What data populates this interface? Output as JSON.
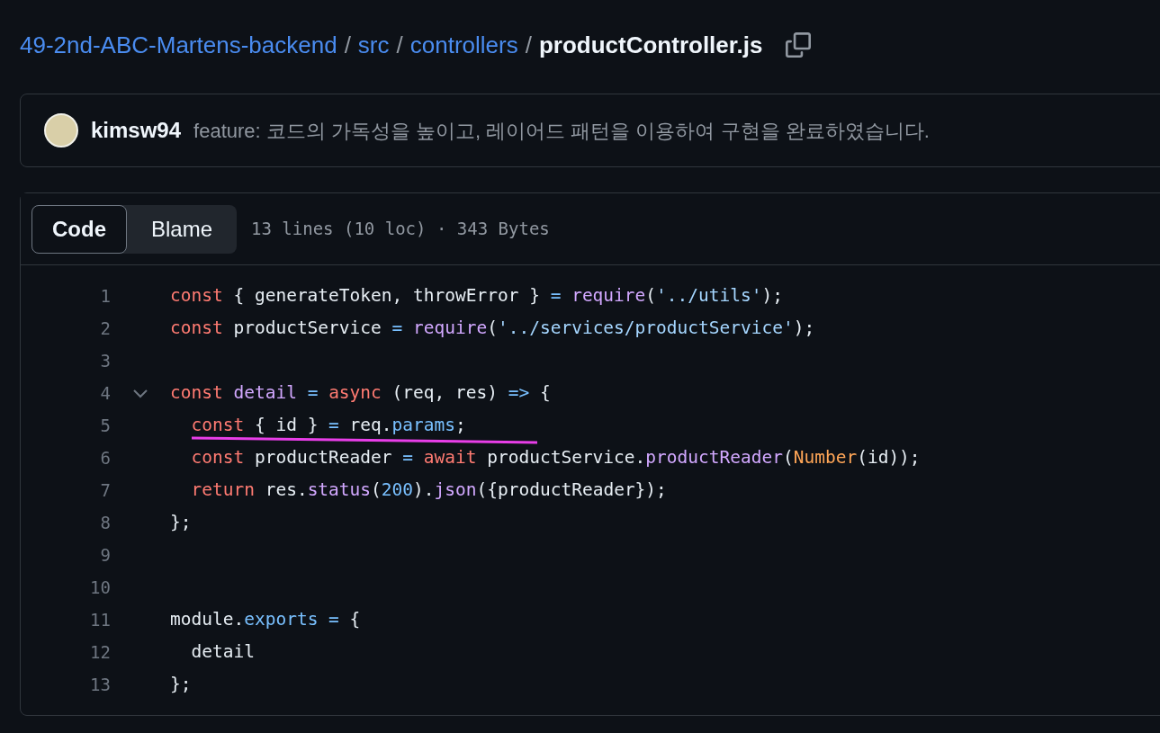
{
  "breadcrumb": [
    {
      "label": "49-2nd-ABC-Martens-backend",
      "kind": "link"
    },
    {
      "label": "src",
      "kind": "link"
    },
    {
      "label": "controllers",
      "kind": "link"
    },
    {
      "label": "productController.js",
      "kind": "current"
    }
  ],
  "breadcrumb_separator": "/",
  "commit": {
    "author": "kimsw94",
    "message": "feature: 코드의 가독성을 높이고, 레이어드 패턴을 이용하여 구현을 완료하였습니다."
  },
  "tabs": [
    {
      "label": "Code",
      "selected": true
    },
    {
      "label": "Blame",
      "selected": false
    }
  ],
  "file_info": "13 lines (10 loc) · 343 Bytes",
  "lines": [
    {
      "number": "1",
      "foldable": false,
      "marked": false,
      "tokens": [
        {
          "t": "const",
          "kind": "kw"
        },
        {
          "t": " { generateToken, throwError } ",
          "kind": "plain"
        },
        {
          "t": "= ",
          "kind": "op"
        },
        {
          "t": "require",
          "kind": "fn"
        },
        {
          "t": "(",
          "kind": "plain"
        },
        {
          "t": "'../utils'",
          "kind": "str"
        },
        {
          "t": ");",
          "kind": "plain"
        }
      ]
    },
    {
      "number": "2",
      "foldable": false,
      "marked": false,
      "tokens": [
        {
          "t": "const",
          "kind": "kw"
        },
        {
          "t": " productService ",
          "kind": "plain"
        },
        {
          "t": "= ",
          "kind": "op"
        },
        {
          "t": "require",
          "kind": "fn"
        },
        {
          "t": "(",
          "kind": "plain"
        },
        {
          "t": "'../services/productService'",
          "kind": "str"
        },
        {
          "t": ");",
          "kind": "plain"
        }
      ]
    },
    {
      "number": "3",
      "foldable": false,
      "marked": false
    },
    {
      "number": "4",
      "foldable": true,
      "marked": false,
      "tokens": [
        {
          "t": "const ",
          "kind": "kw"
        },
        {
          "t": "detail ",
          "kind": "fn"
        },
        {
          "t": "= ",
          "kind": "op"
        },
        {
          "t": "async",
          "kind": "kw"
        },
        {
          "t": " (req, res) ",
          "kind": "plain"
        },
        {
          "t": "=>",
          "kind": "op"
        },
        {
          "t": " {",
          "kind": "plain"
        }
      ]
    },
    {
      "number": "5",
      "foldable": false,
      "marked": true,
      "tokens": [
        {
          "t": "  const",
          "kind": "kw"
        },
        {
          "t": " { id } ",
          "kind": "plain"
        },
        {
          "t": "=",
          "kind": "op"
        },
        {
          "t": " req.",
          "kind": "plain"
        },
        {
          "t": "params",
          "kind": "prop"
        },
        {
          "t": ";",
          "kind": "plain"
        }
      ]
    },
    {
      "number": "6",
      "foldable": false,
      "marked": false,
      "tokens": [
        {
          "t": "  const",
          "kind": "kw"
        },
        {
          "t": " productReader ",
          "kind": "plain"
        },
        {
          "t": "= ",
          "kind": "op"
        },
        {
          "t": "await",
          "kind": "kw"
        },
        {
          "t": " productService.",
          "kind": "plain"
        },
        {
          "t": "productReader",
          "kind": "fn"
        },
        {
          "t": "(",
          "kind": "plain"
        },
        {
          "t": "Number",
          "kind": "cls"
        },
        {
          "t": "(id));",
          "kind": "plain"
        }
      ]
    },
    {
      "number": "7",
      "foldable": false,
      "marked": false,
      "tokens": [
        {
          "t": "  return",
          "kind": "kw"
        },
        {
          "t": " res.",
          "kind": "plain"
        },
        {
          "t": "status",
          "kind": "fn"
        },
        {
          "t": "(",
          "kind": "plain"
        },
        {
          "t": "200",
          "kind": "prop"
        },
        {
          "t": ").",
          "kind": "plain"
        },
        {
          "t": "json",
          "kind": "fn"
        },
        {
          "t": "({productReader});",
          "kind": "plain"
        }
      ]
    },
    {
      "number": "8",
      "foldable": false,
      "marked": false,
      "tokens": [
        {
          "t": "};",
          "kind": "plain"
        }
      ]
    },
    {
      "number": "9",
      "foldable": false,
      "marked": false
    },
    {
      "number": "10",
      "foldable": false,
      "marked": false
    },
    {
      "number": "11",
      "foldable": false,
      "marked": false,
      "tokens": [
        {
          "t": "module.",
          "kind": "plain"
        },
        {
          "t": "exports",
          "kind": "prop"
        },
        {
          "t": " = ",
          "kind": "op"
        },
        {
          "t": "{",
          "kind": "plain"
        }
      ]
    },
    {
      "number": "12",
      "foldable": false,
      "marked": false,
      "tokens": [
        {
          "t": "  detail",
          "kind": "plain"
        }
      ]
    },
    {
      "number": "13",
      "foldable": false,
      "marked": false,
      "tokens": [
        {
          "t": "};",
          "kind": "plain"
        }
      ]
    }
  ]
}
